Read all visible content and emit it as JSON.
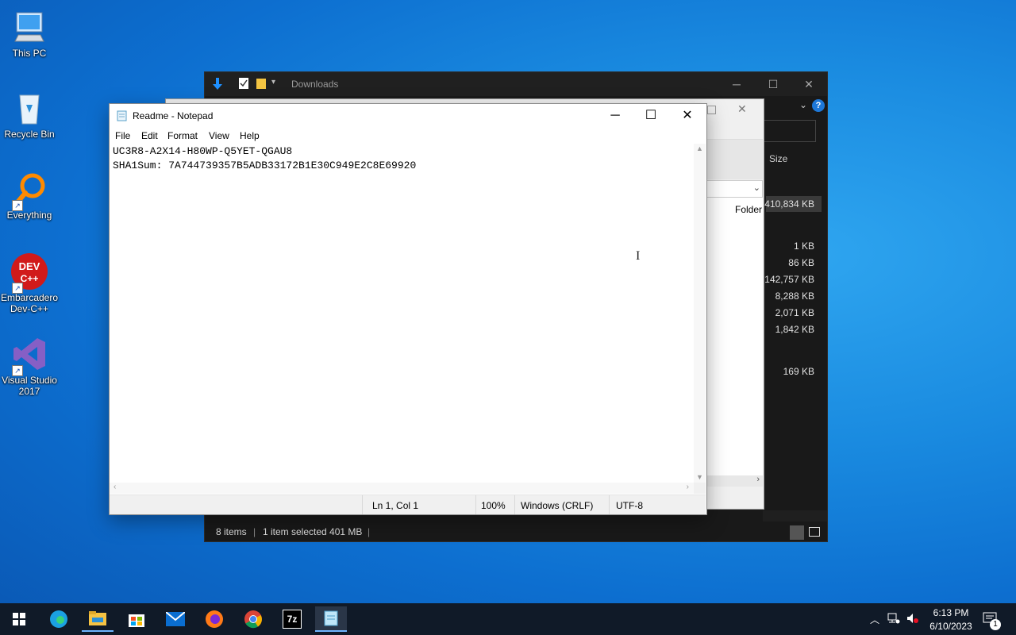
{
  "desktop": {
    "icons": [
      {
        "label": "This PC"
      },
      {
        "label": "Recycle Bin"
      },
      {
        "label": "Everything"
      },
      {
        "label": "Embarcadero Dev-C++",
        "icon_text": "DEV C++"
      },
      {
        "label": "Visual Studio 2017"
      }
    ]
  },
  "explorer": {
    "title": "Downloads",
    "column_size": "Size",
    "type_folder": "Folder",
    "sizes": [
      "410,834 KB",
      "1 KB",
      "86 KB",
      "142,757 KB",
      "8,288 KB",
      "2,071 KB",
      "1,842 KB",
      "169 KB"
    ],
    "status_items": "8 items",
    "status_selected": "1 item selected  401 MB"
  },
  "notepad": {
    "title": "Readme - Notepad",
    "menu": [
      "File",
      "Edit",
      "Format",
      "View",
      "Help"
    ],
    "lines": [
      "UC3R8-A2X14-H80WP-Q5YET-QGAU8",
      "SHA1Sum: 7A744739357B5ADB33172B1E30C949E2C8E69920"
    ],
    "status": {
      "position": "Ln 1, Col 1",
      "zoom": "100%",
      "line_ending": "Windows (CRLF)",
      "encoding": "UTF-8"
    }
  },
  "taskbar": {
    "apps": [
      "start-icon",
      "edge-icon",
      "file-explorer-icon",
      "store-icon",
      "mail-icon",
      "firefox-icon",
      "chrome-icon",
      "7zip-icon",
      "notepad-icon"
    ],
    "time": "6:13 PM",
    "date": "6/10/2023",
    "notification_count": "1",
    "seven_zip_label": "7z"
  }
}
